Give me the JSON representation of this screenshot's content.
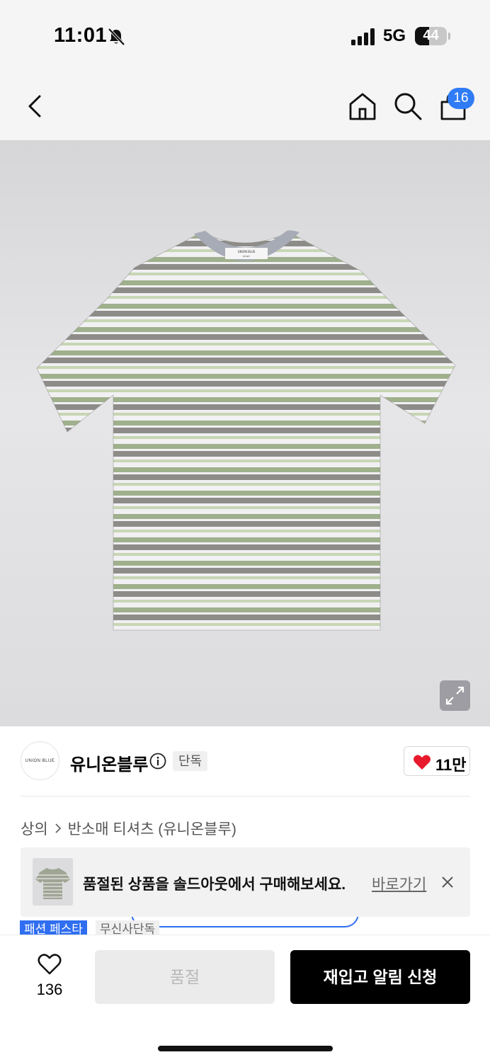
{
  "status_bar": {
    "time": "11:01",
    "network": "5G",
    "battery": "44",
    "battery_level": 0.44
  },
  "nav": {
    "cart_count": "16"
  },
  "product": {
    "image_alt": "striped t-shirt",
    "tshirt_colors": {
      "stripe_green": "#9fb08c",
      "stripe_gray": "#8d8c88",
      "stripe_white": "#f1f0f2",
      "stripe_lightgreen": "#c7d6b4",
      "collar": "#a7abb6"
    },
    "neck_label_line1": "UNION BLUE",
    "neck_label_line2": "STUDY"
  },
  "brand": {
    "logo_text": "UNION BLUE",
    "name": "유니온블루",
    "tag": "단독",
    "like_count": "11만"
  },
  "breadcrumb": {
    "items": [
      "상의",
      "반소매 티셔츠 (유니온블루)"
    ]
  },
  "banner": {
    "message": "품절된 상품을 솔드아웃에서 구매해보세요.",
    "link": "바로가기"
  },
  "peek_tags": {
    "fest": "패션 페스타",
    "musinsa": "무신사단독"
  },
  "bottom_bar": {
    "wish_count": "136",
    "soldout_label": "품절",
    "restock_label": "재입고 알림 신청"
  },
  "colors": {
    "accent_blue": "#2f7cf6",
    "heart_red": "#e8192c",
    "button_black": "#000000"
  }
}
